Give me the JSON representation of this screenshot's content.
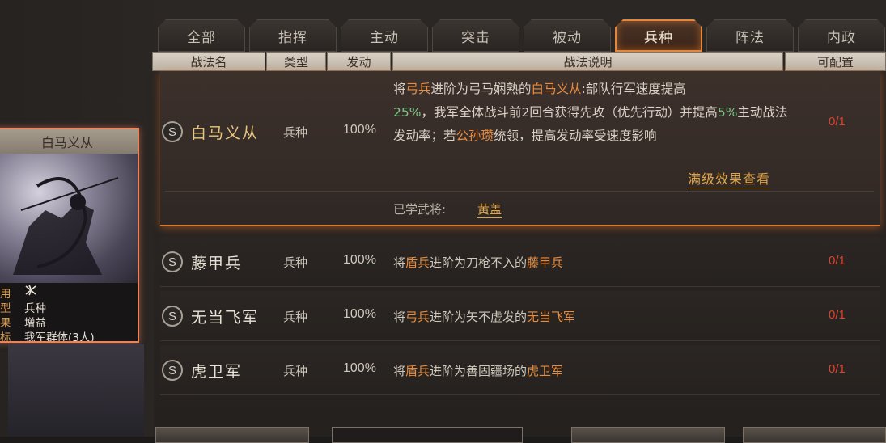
{
  "tabs": [
    {
      "label": "全部"
    },
    {
      "label": "指挥"
    },
    {
      "label": "主动"
    },
    {
      "label": "突击"
    },
    {
      "label": "被动"
    },
    {
      "label": "兵种"
    },
    {
      "label": "阵法"
    },
    {
      "label": "内政"
    }
  ],
  "active_tab": "兵种",
  "headers": {
    "name": "战法名",
    "type": "类型",
    "rate": "发动",
    "desc": "战法说明",
    "config": "可配置"
  },
  "card": {
    "title": "白马义从",
    "info": [
      {
        "key": "用",
        "value": ""
      },
      {
        "key": "型",
        "value": "兵种"
      },
      {
        "key": "果",
        "value": "增益"
      },
      {
        "key": "标",
        "value": "我军群体(3人)"
      }
    ]
  },
  "skills": [
    {
      "grade": "S",
      "name": "白马义从",
      "type": "兵种",
      "rate": "100%",
      "count": "0/1",
      "desc_parts": {
        "p1": "将",
        "p2": "弓兵",
        "p3": "进阶为弓马娴熟的",
        "p4": "白马义从",
        "p5": ":部队行军速度提高",
        "p6": "25%",
        "p7": "，我军全体战斗前2回合获得先攻（优先行动）并提高",
        "p8": "5%",
        "p9": "主动战法发动率；若",
        "p10": "公孙瓒",
        "p11": "统领，提高发动率受速度影响"
      },
      "detail_link": "满级效果查看",
      "learned_label": "已学武将:",
      "learned_name": "黄盖"
    },
    {
      "grade": "S",
      "name": "藤甲兵",
      "type": "兵种",
      "rate": "100%",
      "count": "0/1",
      "desc_parts": {
        "a": "将",
        "b": "盾兵",
        "c": "进阶为刀枪不入的",
        "d": "藤甲兵"
      }
    },
    {
      "grade": "S",
      "name": "无当飞军",
      "type": "兵种",
      "rate": "100%",
      "count": "0/1",
      "desc_parts": {
        "a": "将",
        "b": "弓兵",
        "c": "进阶为矢不虚发的",
        "d": "无当飞军"
      }
    },
    {
      "grade": "S",
      "name": "虎卫军",
      "type": "兵种",
      "rate": "100%",
      "count": "0/1",
      "desc_parts": {
        "a": "将",
        "b": "盾兵",
        "c": "进阶为善固疆场的",
        "d": "虎卫军"
      }
    }
  ],
  "colors": {
    "accent": "#e0883e",
    "highlight_orange": "#e98c3d",
    "highlight_green": "#7ec48a",
    "count_red": "#e0402d"
  }
}
